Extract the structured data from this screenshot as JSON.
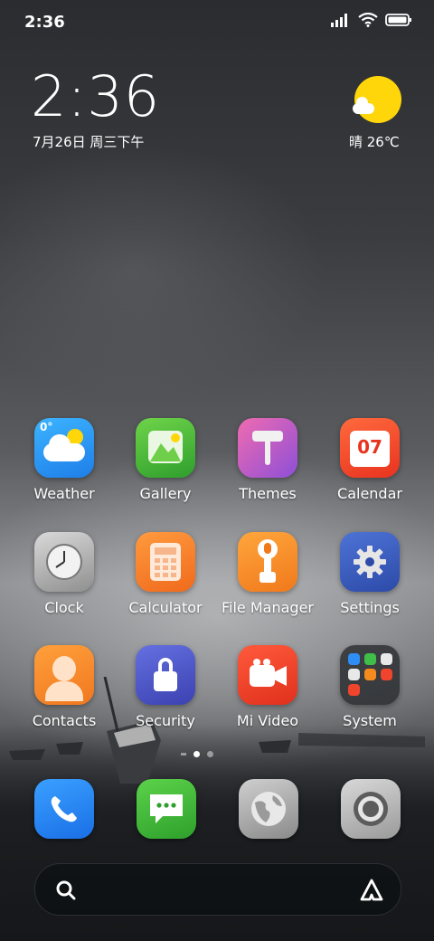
{
  "status_bar": {
    "time": "2:36",
    "icons": [
      "signal-icon",
      "wifi-icon",
      "battery-icon"
    ]
  },
  "clock_widget": {
    "time": "2:36",
    "date": "7月26日 周三下午"
  },
  "weather_widget": {
    "text": "晴 26℃",
    "icon": "sun-cloud-icon"
  },
  "apps": [
    {
      "label": "Weather",
      "icon": "weather-icon",
      "color": "#2a9df4"
    },
    {
      "label": "Gallery",
      "icon": "gallery-icon",
      "color": "#4cbb3a"
    },
    {
      "label": "Themes",
      "icon": "themes-icon",
      "color": "#d0479a"
    },
    {
      "label": "Calendar",
      "icon": "calendar-icon",
      "color": "#f0442c",
      "day": "07"
    },
    {
      "label": "Clock",
      "icon": "clock-icon",
      "color": "#b8b8b8"
    },
    {
      "label": "Calculator",
      "icon": "calculator-icon",
      "color": "#f5792a"
    },
    {
      "label": "File Manager",
      "icon": "file-manager-icon",
      "color": "#f58a1f"
    },
    {
      "label": "Settings",
      "icon": "settings-icon",
      "color": "#3a5fc0"
    },
    {
      "label": "Contacts",
      "icon": "contacts-icon",
      "color": "#f58a22"
    },
    {
      "label": "Security",
      "icon": "security-icon",
      "color": "#5056c8"
    },
    {
      "label": "Mi Video",
      "icon": "video-icon",
      "color": "#f0442c"
    },
    {
      "label": "System",
      "icon": "folder-icon",
      "color": "#3a3c40"
    }
  ],
  "page_indicator": {
    "pages": 3,
    "current": 2
  },
  "dock": [
    {
      "icon": "phone-icon",
      "color": "#1f7ff0"
    },
    {
      "icon": "messages-icon",
      "color": "#3fb83a"
    },
    {
      "icon": "browser-icon",
      "color": "#a8a8a8"
    },
    {
      "icon": "camera-icon",
      "color": "#b5b5b5"
    }
  ],
  "search": {
    "left_icon": "search-icon",
    "right_icon": "assistant-icon"
  }
}
